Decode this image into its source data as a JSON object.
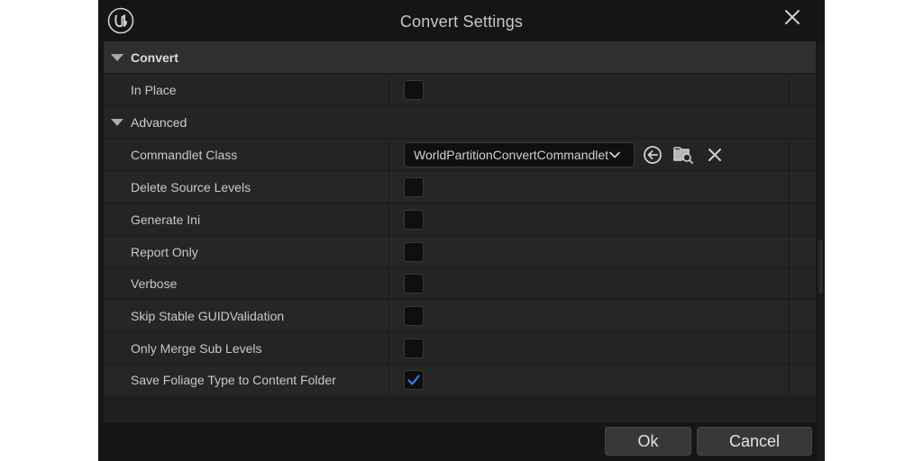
{
  "window": {
    "title": "Convert Settings",
    "logo_icon": "unreal-engine-logo-icon",
    "close_icon": "close-icon"
  },
  "categories": {
    "convert": {
      "label": "Convert"
    },
    "advanced": {
      "label": "Advanced"
    }
  },
  "properties": {
    "in_place": {
      "label": "In Place",
      "checked": false
    },
    "commandlet_class": {
      "label": "Commandlet Class",
      "value": "WorldPartitionConvertCommandlet",
      "icons": [
        "use-selected-arrow-icon",
        "browse-folder-search-icon",
        "clear-x-icon"
      ]
    },
    "delete_source_levels": {
      "label": "Delete Source Levels",
      "checked": false
    },
    "generate_ini": {
      "label": "Generate Ini",
      "checked": false
    },
    "report_only": {
      "label": "Report Only",
      "checked": false
    },
    "verbose": {
      "label": "Verbose",
      "checked": false
    },
    "skip_stable_guid_validation": {
      "label": "Skip Stable GUIDValidation",
      "checked": false
    },
    "only_merge_sub_levels": {
      "label": "Only Merge Sub Levels",
      "checked": false
    },
    "save_foliage_type": {
      "label": "Save Foliage Type to Content Folder",
      "checked": true
    }
  },
  "buttons": {
    "ok": "Ok",
    "cancel": "Cancel"
  },
  "colors": {
    "window_bg": "#151515",
    "panel_bg": "#242424",
    "category_bg": "#2f2f2f",
    "checkbox_bg": "#0f0f0f",
    "check_accent": "#2f7ee6",
    "text": "#c8c8c8"
  }
}
